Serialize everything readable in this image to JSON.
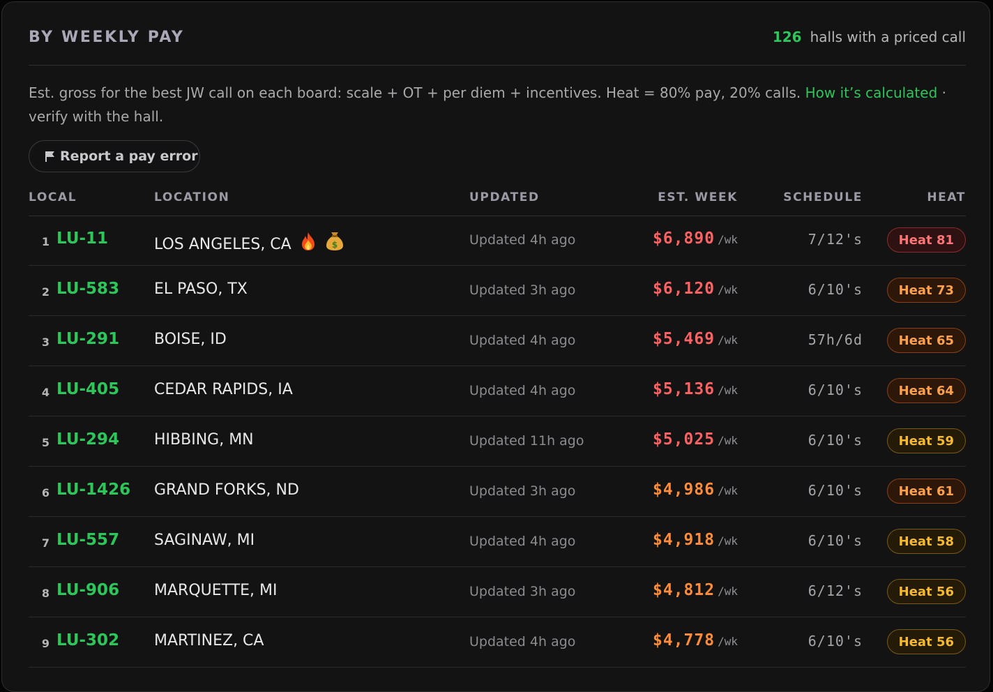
{
  "panel": {
    "title": "BY WEEKLY PAY",
    "count": "126",
    "count_label": "halls with a priced call",
    "description": "Est. gross for the best JW call on each board: scale + OT + per diem + incentives. Heat = 80% pay, 20% calls.",
    "calc_link": "How it’s calculated",
    "description_tail": " · verify with the hall.",
    "report_button": "Report a pay error"
  },
  "columns": {
    "local": "LOCAL",
    "location": "LOCATION",
    "updated": "UPDATED",
    "est_week": "EST. WEEK",
    "schedule": "SCHEDULE",
    "heat": "HEAT"
  },
  "rows": [
    {
      "rank": "1",
      "local": "LU-11",
      "location": "LOS ANGELES, CA",
      "emojis": [
        "fire-emoji",
        "money-bag-emoji"
      ],
      "updated": "Updated 4h ago",
      "pay": "$6,890",
      "unit": "/wk",
      "schedule": "7/12's",
      "heat": "Heat 81",
      "pay_color": "#ff6262",
      "badge": "red"
    },
    {
      "rank": "2",
      "local": "LU-583",
      "location": "EL PASO, TX",
      "emojis": [],
      "updated": "Updated 3h ago",
      "pay": "$6,120",
      "unit": "/wk",
      "schedule": "6/10's",
      "heat": "Heat 73",
      "pay_color": "#ff6262",
      "badge": "orange"
    },
    {
      "rank": "3",
      "local": "LU-291",
      "location": "BOISE, ID",
      "emojis": [],
      "updated": "Updated 4h ago",
      "pay": "$5,469",
      "unit": "/wk",
      "schedule": "57h/6d",
      "heat": "Heat 65",
      "pay_color": "#ff6262",
      "badge": "orange"
    },
    {
      "rank": "4",
      "local": "LU-405",
      "location": "CEDAR RAPIDS, IA",
      "emojis": [],
      "updated": "Updated 4h ago",
      "pay": "$5,136",
      "unit": "/wk",
      "schedule": "6/10's",
      "heat": "Heat 64",
      "pay_color": "#ff6262",
      "badge": "orange"
    },
    {
      "rank": "5",
      "local": "LU-294",
      "location": "HIBBING, MN",
      "emojis": [],
      "updated": "Updated 11h ago",
      "pay": "$5,025",
      "unit": "/wk",
      "schedule": "6/10's",
      "heat": "Heat 59",
      "pay_color": "#ff6262",
      "badge": "yellow"
    },
    {
      "rank": "6",
      "local": "LU-1426",
      "location": "GRAND FORKS, ND",
      "emojis": [],
      "updated": "Updated 3h ago",
      "pay": "$4,986",
      "unit": "/wk",
      "schedule": "6/10's",
      "heat": "Heat 61",
      "pay_color": "#ff8c3a",
      "badge": "orange"
    },
    {
      "rank": "7",
      "local": "LU-557",
      "location": "SAGINAW, MI",
      "emojis": [],
      "updated": "Updated 4h ago",
      "pay": "$4,918",
      "unit": "/wk",
      "schedule": "6/10's",
      "heat": "Heat 58",
      "pay_color": "#ff8c3a",
      "badge": "yellow"
    },
    {
      "rank": "8",
      "local": "LU-906",
      "location": "MARQUETTE, MI",
      "emojis": [],
      "updated": "Updated 3h ago",
      "pay": "$4,812",
      "unit": "/wk",
      "schedule": "6/12's",
      "heat": "Heat 56",
      "pay_color": "#ff8c3a",
      "badge": "yellow"
    },
    {
      "rank": "9",
      "local": "LU-302",
      "location": "MARTINEZ, CA",
      "emojis": [],
      "updated": "Updated 4h ago",
      "pay": "$4,778",
      "unit": "/wk",
      "schedule": "6/10's",
      "heat": "Heat 56",
      "pay_color": "#ff8c3a",
      "badge": "yellow"
    }
  ]
}
